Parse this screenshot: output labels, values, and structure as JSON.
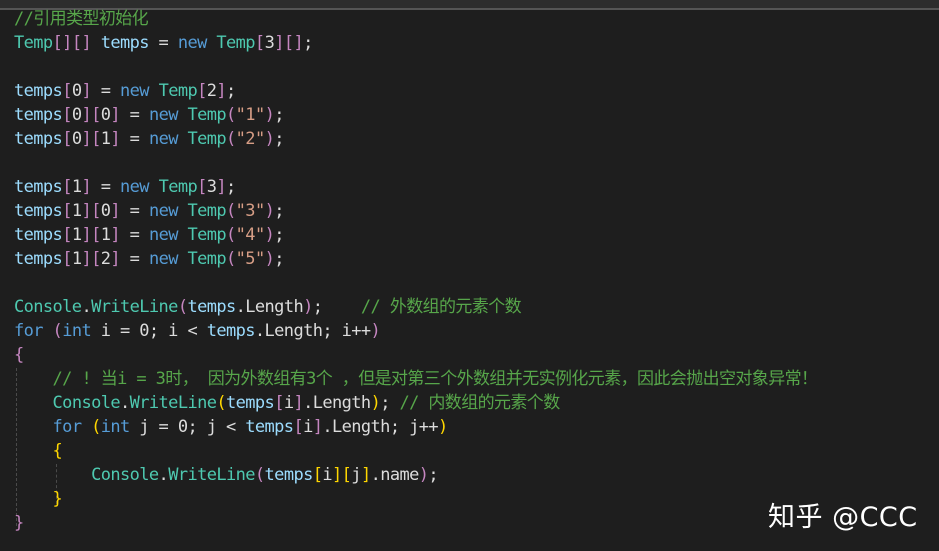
{
  "colors": {
    "background": "#1e1e1e",
    "comment": "#57a64a",
    "type": "#4ec9b0",
    "keyword": "#569cd6",
    "plain": "#dcdcdc",
    "variable": "#9cdcfe",
    "string": "#d69d85",
    "bracket_purple": "#c586c0",
    "bracket_yellow": "#ffd700"
  },
  "code_lines": [
    [
      {
        "t": "//引用类型初始化",
        "c": "comment"
      }
    ],
    [
      {
        "t": "Temp",
        "c": "type"
      },
      {
        "t": "[][]",
        "c": "bracket_purple"
      },
      {
        "t": " ",
        "c": "plain"
      },
      {
        "t": "temps",
        "c": "variable"
      },
      {
        "t": " = ",
        "c": "plain"
      },
      {
        "t": "new",
        "c": "keyword"
      },
      {
        "t": " ",
        "c": "plain"
      },
      {
        "t": "Temp",
        "c": "type"
      },
      {
        "t": "[",
        "c": "bracket_purple"
      },
      {
        "t": "3",
        "c": "plain"
      },
      {
        "t": "][]",
        "c": "bracket_purple"
      },
      {
        "t": ";",
        "c": "plain"
      }
    ],
    [],
    [
      {
        "t": "temps",
        "c": "variable"
      },
      {
        "t": "[",
        "c": "bracket_purple"
      },
      {
        "t": "0",
        "c": "plain"
      },
      {
        "t": "]",
        "c": "bracket_purple"
      },
      {
        "t": " = ",
        "c": "plain"
      },
      {
        "t": "new",
        "c": "keyword"
      },
      {
        "t": " ",
        "c": "plain"
      },
      {
        "t": "Temp",
        "c": "type"
      },
      {
        "t": "[",
        "c": "bracket_purple"
      },
      {
        "t": "2",
        "c": "plain"
      },
      {
        "t": "]",
        "c": "bracket_purple"
      },
      {
        "t": ";",
        "c": "plain"
      }
    ],
    [
      {
        "t": "temps",
        "c": "variable"
      },
      {
        "t": "[",
        "c": "bracket_purple"
      },
      {
        "t": "0",
        "c": "plain"
      },
      {
        "t": "][",
        "c": "bracket_purple"
      },
      {
        "t": "0",
        "c": "plain"
      },
      {
        "t": "]",
        "c": "bracket_purple"
      },
      {
        "t": " = ",
        "c": "plain"
      },
      {
        "t": "new",
        "c": "keyword"
      },
      {
        "t": " ",
        "c": "plain"
      },
      {
        "t": "Temp",
        "c": "type"
      },
      {
        "t": "(",
        "c": "bracket_purple"
      },
      {
        "t": "\"1\"",
        "c": "string"
      },
      {
        "t": ")",
        "c": "bracket_purple"
      },
      {
        "t": ";",
        "c": "plain"
      }
    ],
    [
      {
        "t": "temps",
        "c": "variable"
      },
      {
        "t": "[",
        "c": "bracket_purple"
      },
      {
        "t": "0",
        "c": "plain"
      },
      {
        "t": "][",
        "c": "bracket_purple"
      },
      {
        "t": "1",
        "c": "plain"
      },
      {
        "t": "]",
        "c": "bracket_purple"
      },
      {
        "t": " = ",
        "c": "plain"
      },
      {
        "t": "new",
        "c": "keyword"
      },
      {
        "t": " ",
        "c": "plain"
      },
      {
        "t": "Temp",
        "c": "type"
      },
      {
        "t": "(",
        "c": "bracket_purple"
      },
      {
        "t": "\"2\"",
        "c": "string"
      },
      {
        "t": ")",
        "c": "bracket_purple"
      },
      {
        "t": ";",
        "c": "plain"
      }
    ],
    [],
    [
      {
        "t": "temps",
        "c": "variable"
      },
      {
        "t": "[",
        "c": "bracket_purple"
      },
      {
        "t": "1",
        "c": "plain"
      },
      {
        "t": "]",
        "c": "bracket_purple"
      },
      {
        "t": " = ",
        "c": "plain"
      },
      {
        "t": "new",
        "c": "keyword"
      },
      {
        "t": " ",
        "c": "plain"
      },
      {
        "t": "Temp",
        "c": "type"
      },
      {
        "t": "[",
        "c": "bracket_purple"
      },
      {
        "t": "3",
        "c": "plain"
      },
      {
        "t": "]",
        "c": "bracket_purple"
      },
      {
        "t": ";",
        "c": "plain"
      }
    ],
    [
      {
        "t": "temps",
        "c": "variable"
      },
      {
        "t": "[",
        "c": "bracket_purple"
      },
      {
        "t": "1",
        "c": "plain"
      },
      {
        "t": "][",
        "c": "bracket_purple"
      },
      {
        "t": "0",
        "c": "plain"
      },
      {
        "t": "]",
        "c": "bracket_purple"
      },
      {
        "t": " = ",
        "c": "plain"
      },
      {
        "t": "new",
        "c": "keyword"
      },
      {
        "t": " ",
        "c": "plain"
      },
      {
        "t": "Temp",
        "c": "type"
      },
      {
        "t": "(",
        "c": "bracket_purple"
      },
      {
        "t": "\"3\"",
        "c": "string"
      },
      {
        "t": ")",
        "c": "bracket_purple"
      },
      {
        "t": ";",
        "c": "plain"
      }
    ],
    [
      {
        "t": "temps",
        "c": "variable"
      },
      {
        "t": "[",
        "c": "bracket_purple"
      },
      {
        "t": "1",
        "c": "plain"
      },
      {
        "t": "][",
        "c": "bracket_purple"
      },
      {
        "t": "1",
        "c": "plain"
      },
      {
        "t": "]",
        "c": "bracket_purple"
      },
      {
        "t": " = ",
        "c": "plain"
      },
      {
        "t": "new",
        "c": "keyword"
      },
      {
        "t": " ",
        "c": "plain"
      },
      {
        "t": "Temp",
        "c": "type"
      },
      {
        "t": "(",
        "c": "bracket_purple"
      },
      {
        "t": "\"4\"",
        "c": "string"
      },
      {
        "t": ")",
        "c": "bracket_purple"
      },
      {
        "t": ";",
        "c": "plain"
      }
    ],
    [
      {
        "t": "temps",
        "c": "variable"
      },
      {
        "t": "[",
        "c": "bracket_purple"
      },
      {
        "t": "1",
        "c": "plain"
      },
      {
        "t": "][",
        "c": "bracket_purple"
      },
      {
        "t": "2",
        "c": "plain"
      },
      {
        "t": "]",
        "c": "bracket_purple"
      },
      {
        "t": " = ",
        "c": "plain"
      },
      {
        "t": "new",
        "c": "keyword"
      },
      {
        "t": " ",
        "c": "plain"
      },
      {
        "t": "Temp",
        "c": "type"
      },
      {
        "t": "(",
        "c": "bracket_purple"
      },
      {
        "t": "\"5\"",
        "c": "string"
      },
      {
        "t": ")",
        "c": "bracket_purple"
      },
      {
        "t": ";",
        "c": "plain"
      }
    ],
    [],
    [
      {
        "t": "Console",
        "c": "type"
      },
      {
        "t": ".",
        "c": "plain"
      },
      {
        "t": "WriteLine",
        "c": "type"
      },
      {
        "t": "(",
        "c": "bracket_purple"
      },
      {
        "t": "temps",
        "c": "variable"
      },
      {
        "t": ".Length",
        "c": "plain"
      },
      {
        "t": ")",
        "c": "bracket_purple"
      },
      {
        "t": ";    ",
        "c": "plain"
      },
      {
        "t": "// 外数组的元素个数",
        "c": "comment"
      }
    ],
    [
      {
        "t": "for",
        "c": "keyword"
      },
      {
        "t": " ",
        "c": "plain"
      },
      {
        "t": "(",
        "c": "bracket_purple"
      },
      {
        "t": "int",
        "c": "keyword"
      },
      {
        "t": " i = 0; i < ",
        "c": "plain"
      },
      {
        "t": "temps",
        "c": "variable"
      },
      {
        "t": ".Length; i++",
        "c": "plain"
      },
      {
        "t": ")",
        "c": "bracket_purple"
      }
    ],
    [
      {
        "t": "{",
        "c": "bracket_purple"
      }
    ],
    [
      {
        "t": "    ",
        "c": "plain"
      },
      {
        "t": "// ! 当i = 3时， 因为外数组有3个 ，但是对第三个外数组并无实例化元素，因此会抛出空对象异常！",
        "c": "comment"
      }
    ],
    [
      {
        "t": "    ",
        "c": "plain"
      },
      {
        "t": "Console",
        "c": "type"
      },
      {
        "t": ".",
        "c": "plain"
      },
      {
        "t": "WriteLine",
        "c": "type"
      },
      {
        "t": "(",
        "c": "bracket_yellow"
      },
      {
        "t": "temps",
        "c": "variable"
      },
      {
        "t": "[",
        "c": "bracket_purple"
      },
      {
        "t": "i",
        "c": "plain"
      },
      {
        "t": "]",
        "c": "bracket_purple"
      },
      {
        "t": ".Length",
        "c": "plain"
      },
      {
        "t": ")",
        "c": "bracket_yellow"
      },
      {
        "t": "; ",
        "c": "plain"
      },
      {
        "t": "// 内数组的元素个数",
        "c": "comment"
      }
    ],
    [
      {
        "t": "    ",
        "c": "plain"
      },
      {
        "t": "for",
        "c": "keyword"
      },
      {
        "t": " ",
        "c": "plain"
      },
      {
        "t": "(",
        "c": "bracket_yellow"
      },
      {
        "t": "int",
        "c": "keyword"
      },
      {
        "t": " j = 0; j < ",
        "c": "plain"
      },
      {
        "t": "temps",
        "c": "variable"
      },
      {
        "t": "[",
        "c": "bracket_purple"
      },
      {
        "t": "i",
        "c": "plain"
      },
      {
        "t": "]",
        "c": "bracket_purple"
      },
      {
        "t": ".Length; j++",
        "c": "plain"
      },
      {
        "t": ")",
        "c": "bracket_yellow"
      }
    ],
    [
      {
        "t": "    ",
        "c": "plain"
      },
      {
        "t": "{",
        "c": "bracket_yellow"
      }
    ],
    [
      {
        "t": "        ",
        "c": "plain"
      },
      {
        "t": "Console",
        "c": "type"
      },
      {
        "t": ".",
        "c": "plain"
      },
      {
        "t": "WriteLine",
        "c": "type"
      },
      {
        "t": "(",
        "c": "bracket_purple"
      },
      {
        "t": "temps",
        "c": "variable"
      },
      {
        "t": "[",
        "c": "bracket_yellow"
      },
      {
        "t": "i",
        "c": "plain"
      },
      {
        "t": "][",
        "c": "bracket_yellow"
      },
      {
        "t": "j",
        "c": "plain"
      },
      {
        "t": "]",
        "c": "bracket_yellow"
      },
      {
        "t": ".name",
        "c": "plain"
      },
      {
        "t": ")",
        "c": "bracket_purple"
      },
      {
        "t": ";",
        "c": "plain"
      }
    ],
    [
      {
        "t": "    ",
        "c": "plain"
      },
      {
        "t": "}",
        "c": "bracket_yellow"
      }
    ],
    [
      {
        "t": "}",
        "c": "bracket_purple"
      }
    ]
  ],
  "watermark": "知乎 @CCC"
}
